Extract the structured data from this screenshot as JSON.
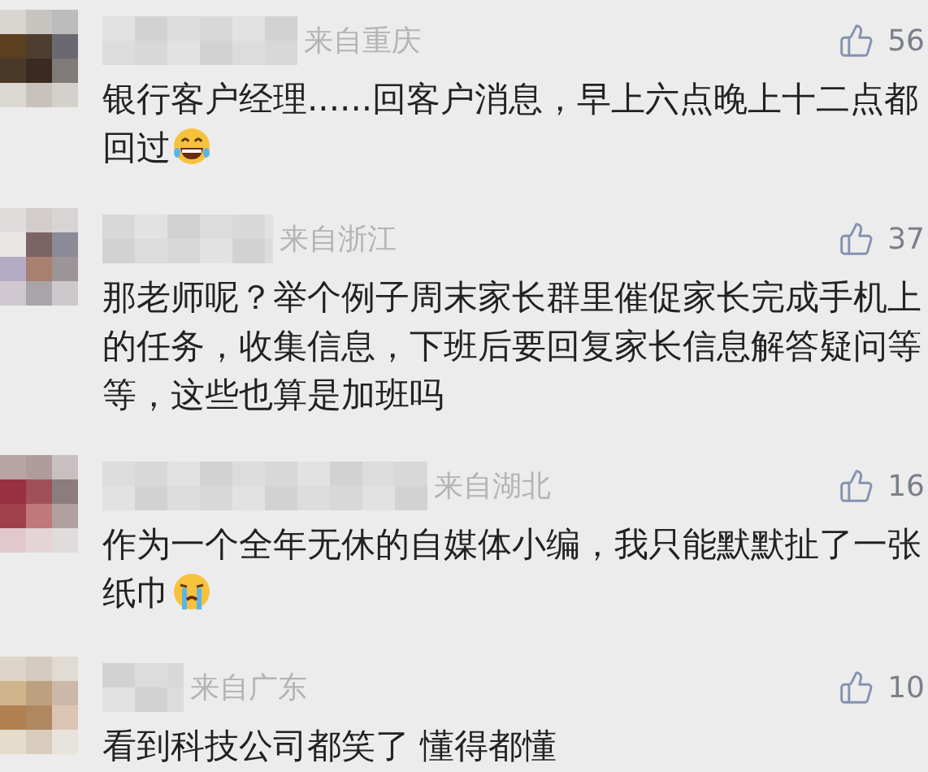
{
  "comments": [
    {
      "location": "来自重庆",
      "likes": "56",
      "text": "银行客户经理......回客户消息，早上六点晚上十二点都回过",
      "emoji": {
        "kind": "laughing"
      }
    },
    {
      "location": "来自浙江",
      "likes": "37",
      "text": "那老师呢？举个例子周末家长群里催促家长完成手机上的任务，收集信息，下班后要回复家长信息解答疑问等等，这些也算是加班吗"
    },
    {
      "location": "来自湖北",
      "likes": "16",
      "text": "作为一个全年无休的自媒体小编，我只能默默扯了一张纸巾",
      "emoji": {
        "kind": "crying"
      }
    },
    {
      "location": "来自广东",
      "likes": "10",
      "text": "看到科技公司都笑了 懂得都懂"
    }
  ]
}
